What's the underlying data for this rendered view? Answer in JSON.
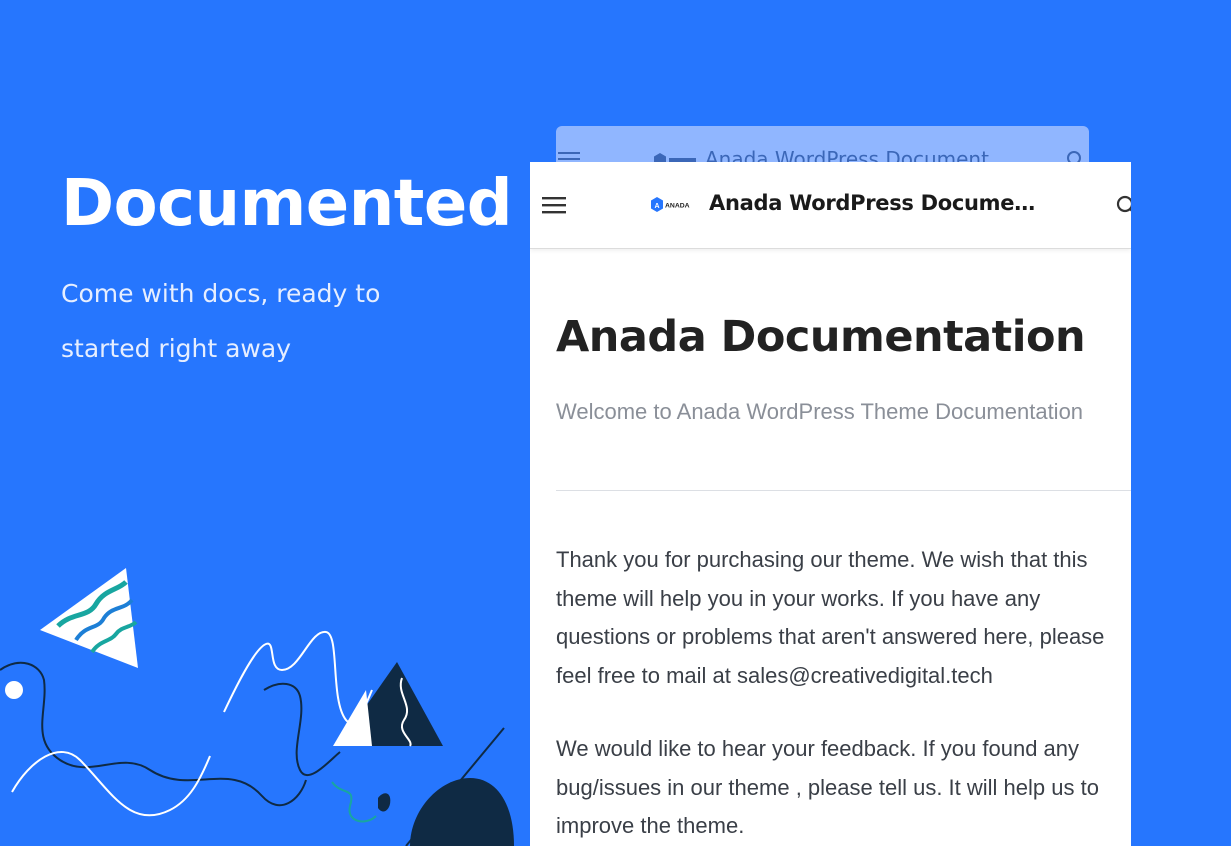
{
  "hero": {
    "title": "Documented",
    "subtitle": "Come with docs, ready to started right away"
  },
  "ghost_header": {
    "title": "Anada WordPress Document"
  },
  "header": {
    "logo_text": "ANADA",
    "title": "Anada WordPress Document..."
  },
  "doc": {
    "title": "Anada Documentation",
    "subtitle": "Welcome to Anada WordPress Theme Documentation",
    "paragraph1": "Thank you for purchasing our theme. We wish that this theme will help you in your works. If you have any questions or problems that aren't answered here, please feel free to mail at sales@creativedigital.tech",
    "paragraph2": "We would like to hear your feedback. If you found any bug/issues in our theme , please tell us. It will help us to improve the theme."
  },
  "colors": {
    "background": "#2676fe",
    "card": "#ffffff",
    "ghost_card": "#90b6ff",
    "dark_navy": "#0f2a44",
    "teal": "#18a6a0"
  },
  "icons": {
    "menu": "hamburger-menu-icon",
    "search": "search-icon",
    "logo": "anada-logo-icon"
  }
}
